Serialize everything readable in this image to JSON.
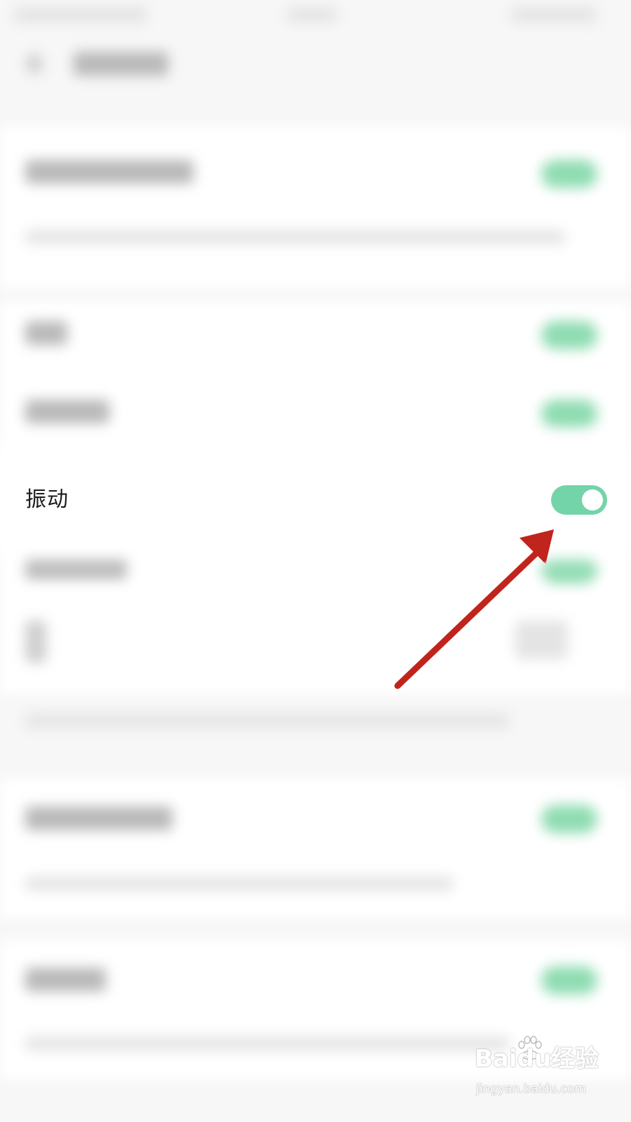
{
  "settings": {
    "vibration": {
      "label": "振动",
      "enabled": true
    }
  },
  "colors": {
    "toggle_on": "#74d4a9",
    "toggle_knob": "#ffffff",
    "arrow": "#c0241c",
    "background": "#f7f7f7"
  },
  "annotation": {
    "type": "arrow",
    "points_to": "vibration-toggle"
  },
  "watermark": {
    "brand": "Baidu经验",
    "url": "jingyan.baidu.com",
    "icon": "paw-icon"
  }
}
